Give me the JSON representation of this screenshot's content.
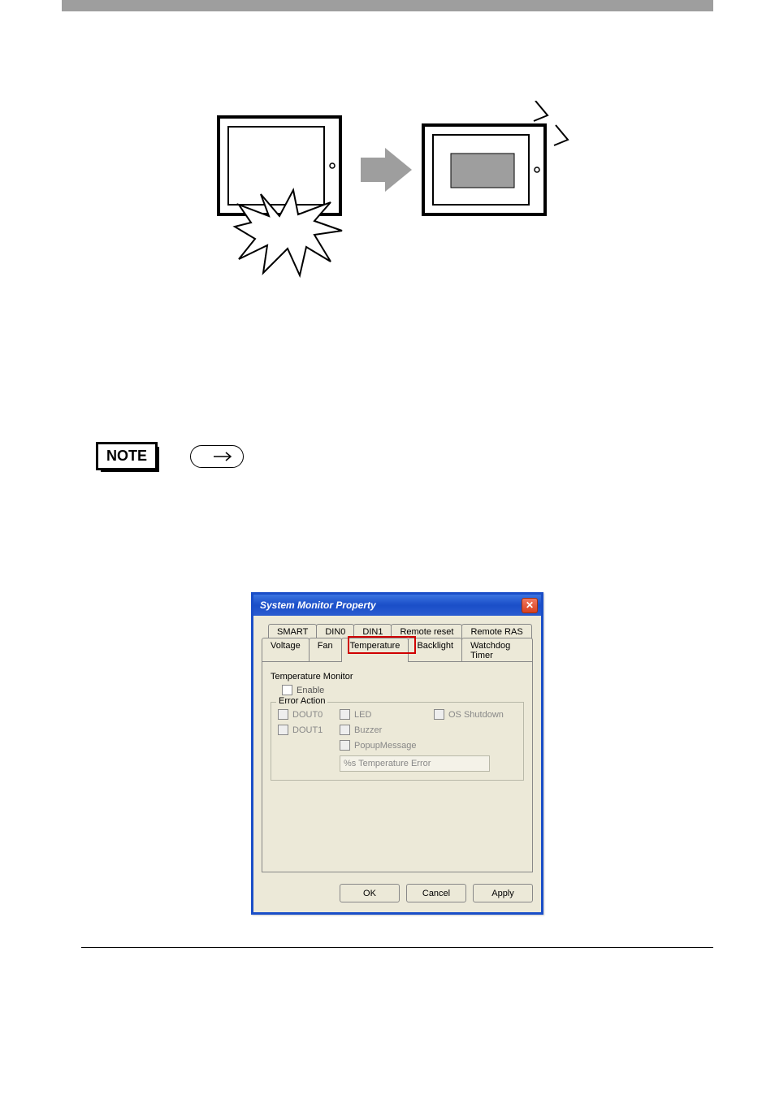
{
  "note": {
    "label": "NOTE"
  },
  "dialog": {
    "title": "System Monitor Property",
    "tabs_upper": [
      "SMART",
      "DIN0",
      "DIN1",
      "Remote reset",
      "Remote RAS"
    ],
    "tabs_lower": [
      "Voltage",
      "Fan",
      "Temperature",
      "Backlight",
      "Watchdog Timer"
    ],
    "active_tab": "Temperature",
    "section_label": "Temperature Monitor",
    "enable_label": "Enable",
    "fieldset_legend": "Error Action",
    "actions": {
      "dout0": "DOUT0",
      "dout1": "DOUT1",
      "led": "LED",
      "buzzer": "Buzzer",
      "popup": "PopupMessage",
      "shutdown": "OS Shutdown"
    },
    "popup_text": "%s Temperature Error",
    "buttons": {
      "ok": "OK",
      "cancel": "Cancel",
      "apply": "Apply"
    }
  }
}
